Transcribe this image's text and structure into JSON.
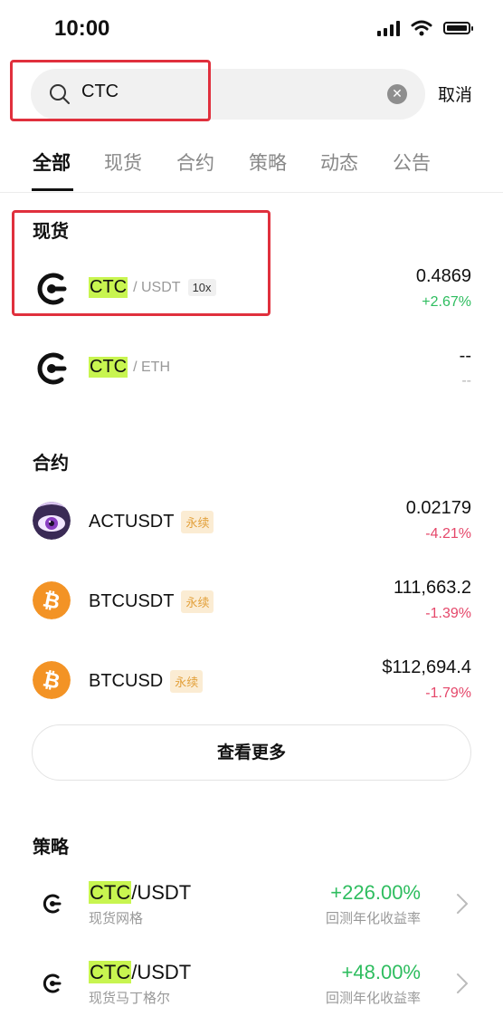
{
  "status": {
    "time": "10:00"
  },
  "search": {
    "query": "CTC",
    "cancel_label": "取消"
  },
  "tabs": [
    {
      "label": "全部",
      "active": true
    },
    {
      "label": "现货"
    },
    {
      "label": "合约"
    },
    {
      "label": "策略"
    },
    {
      "label": "动态"
    },
    {
      "label": "公告"
    }
  ],
  "spot": {
    "title": "现货",
    "items": [
      {
        "base": "CTC",
        "quote": "/ USDT",
        "leverage": "10x",
        "price": "0.4869",
        "change": "+2.67%"
      },
      {
        "base": "CTC",
        "quote": "/ ETH",
        "price": "--",
        "change": "--"
      }
    ]
  },
  "futures": {
    "title": "合约",
    "tag": "永续",
    "items": [
      {
        "symbol": "ACTUSDT",
        "price": "0.02179",
        "change": "-4.21%"
      },
      {
        "symbol": "BTCUSDT",
        "price": "111,663.2",
        "change": "-1.39%"
      },
      {
        "symbol": "BTCUSD",
        "price": "$112,694.4",
        "change": "-1.79%"
      }
    ],
    "more_label": "查看更多"
  },
  "strategy": {
    "title": "策略",
    "metric_label": "回测年化收益率",
    "items": [
      {
        "base": "CTC",
        "quote": "/USDT",
        "type": "现货网格",
        "return": "+226.00%"
      },
      {
        "base": "CTC",
        "quote": "/USDT",
        "type": "现货马丁格尔",
        "return": "+48.00%"
      }
    ]
  },
  "colors": {
    "up": "#2ebd5f",
    "down": "#e5476a",
    "highlight": "#c8f550",
    "annotation": "#e0303d"
  },
  "icons": [
    "signal-icon",
    "wifi-icon",
    "battery-icon",
    "search-icon",
    "clear-icon",
    "ctc-logo-icon",
    "act-logo-icon",
    "bitcoin-logo-icon",
    "chevron-right-icon"
  ]
}
